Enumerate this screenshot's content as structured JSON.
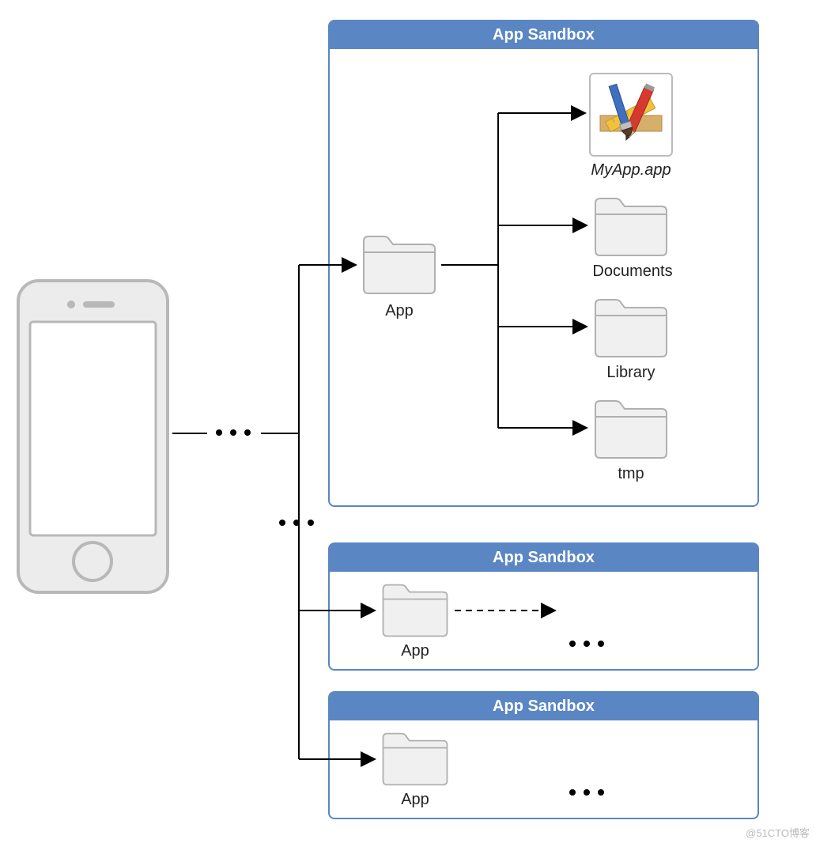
{
  "sandbox1": {
    "title": "App Sandbox",
    "app_folder_label": "App",
    "children": {
      "bundle_label": "MyApp.app",
      "documents_label": "Documents",
      "library_label": "Library",
      "tmp_label": "tmp"
    }
  },
  "sandbox2": {
    "title": "App Sandbox",
    "app_folder_label": "App"
  },
  "sandbox3": {
    "title": "App Sandbox",
    "app_folder_label": "App"
  },
  "watermark": "@51CTO博客"
}
